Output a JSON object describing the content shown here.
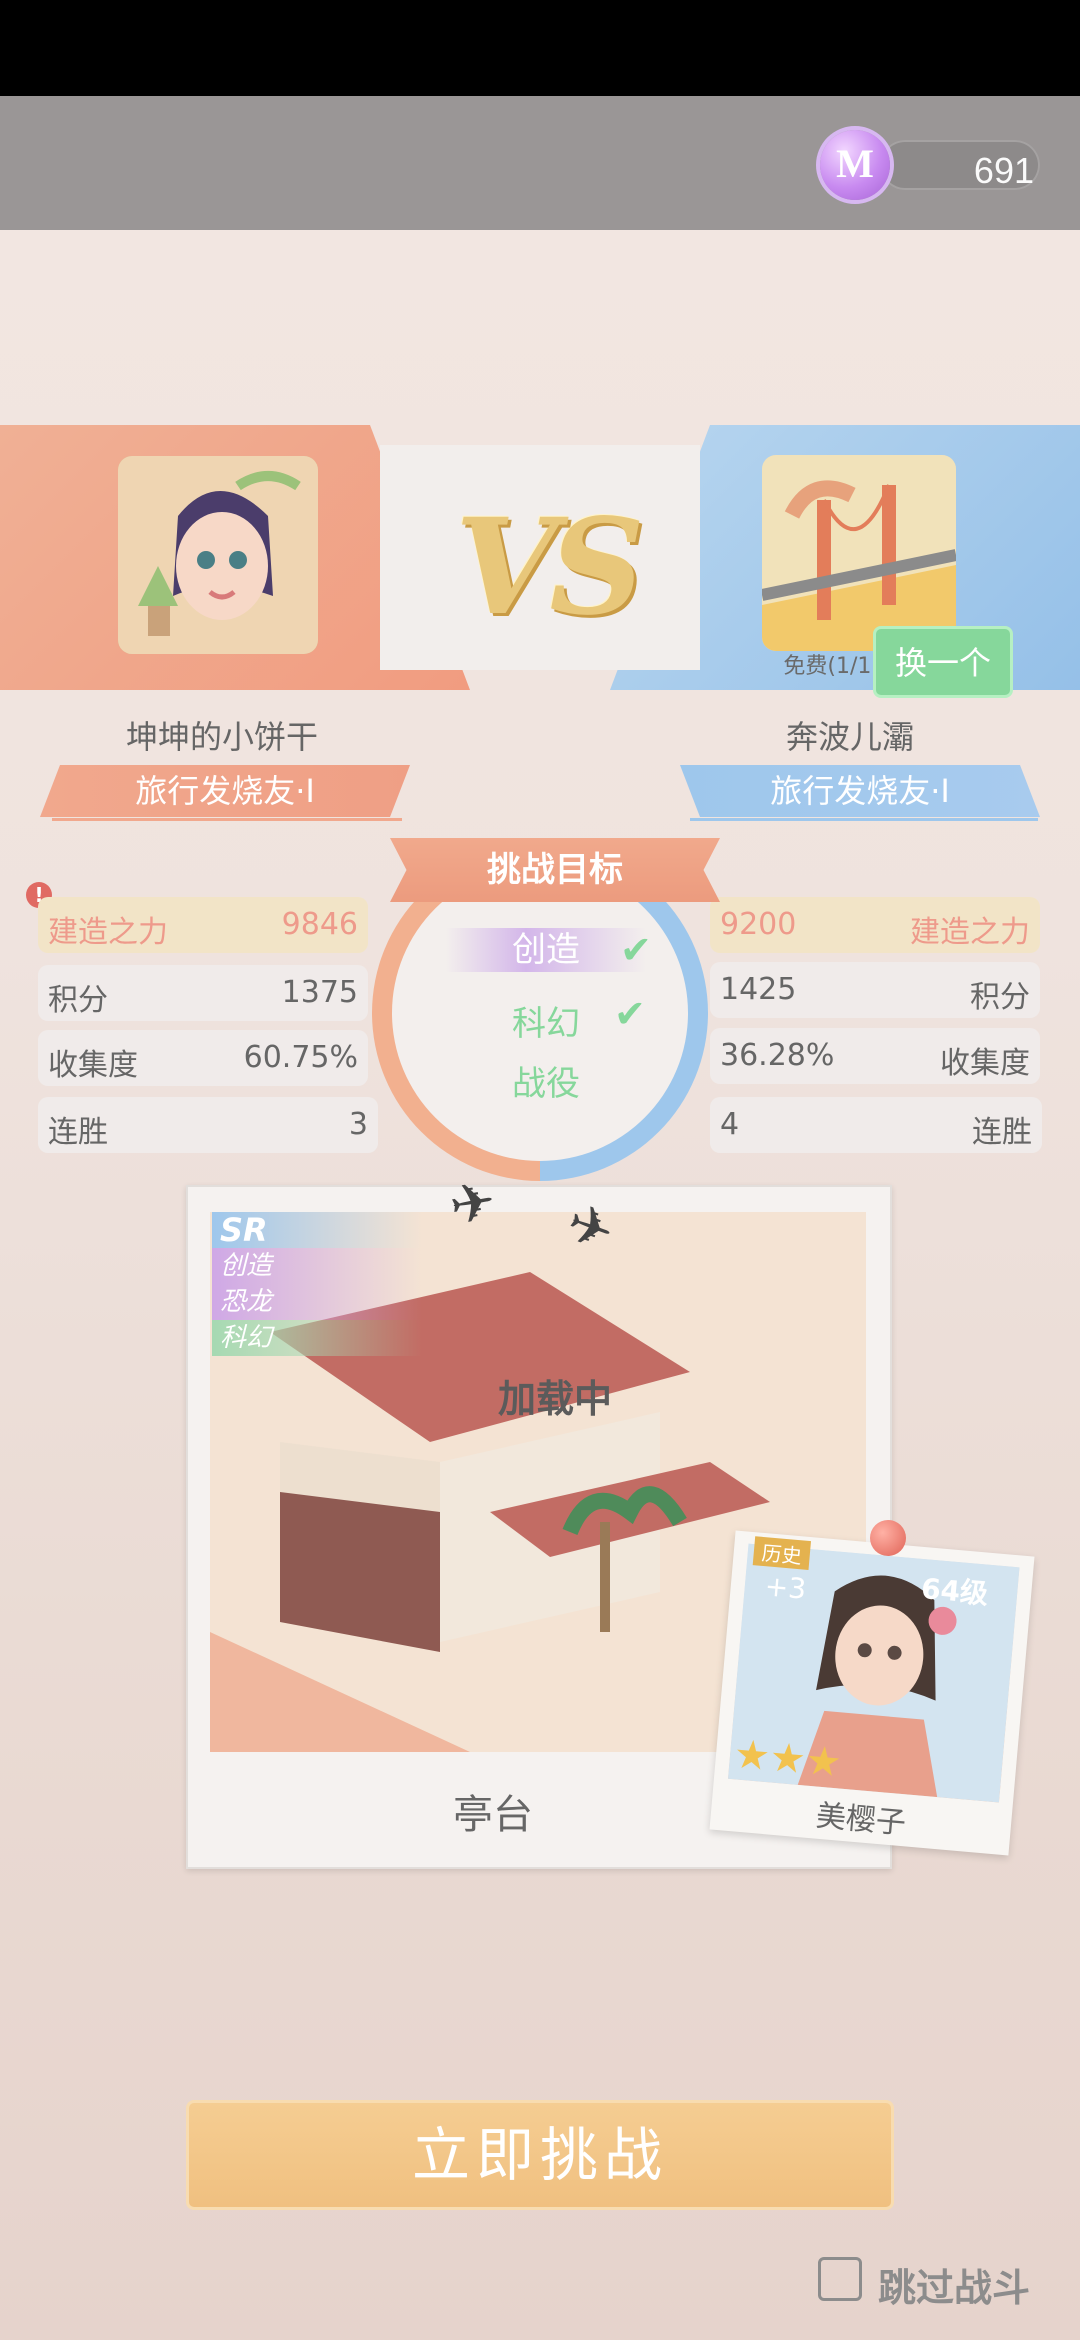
{
  "topbar": {
    "currency_value": "691",
    "currency_icon": "m-coin-icon",
    "coin_letter": "M"
  },
  "vs": {
    "label": "VS"
  },
  "player_left": {
    "name": "坤坤的小饼干",
    "rank": "旅行发烧友·I"
  },
  "player_right": {
    "name": "奔波儿灞",
    "rank": "旅行发烧友·I",
    "free_text": "免费(1/1)",
    "swap_button": "换一个"
  },
  "stats": {
    "rows": [
      {
        "label": "建造之力",
        "left": "9846",
        "right": "9200"
      },
      {
        "label": "积分",
        "left": "1375",
        "right": "1425"
      },
      {
        "label": "收集度",
        "left": "60.75%",
        "right": "36.28%"
      },
      {
        "label": "连胜",
        "left": "3",
        "right": "4"
      }
    ],
    "warn_symbol": "!"
  },
  "challenge": {
    "title": "挑战目标",
    "goals": [
      "创造",
      "科幻",
      "战役"
    ],
    "check": "✔"
  },
  "card": {
    "rarity": "SR",
    "tags": [
      "创造",
      "恐龙",
      "科幻"
    ],
    "name": "亭台",
    "loading": "加载中",
    "plane": "✈"
  },
  "character": {
    "name": "美樱子",
    "level": "64级",
    "tag": "历史",
    "bonus": "+3",
    "stars": "★★★"
  },
  "actions": {
    "challenge_button": "立即挑战",
    "skip_label": "跳过战斗"
  }
}
